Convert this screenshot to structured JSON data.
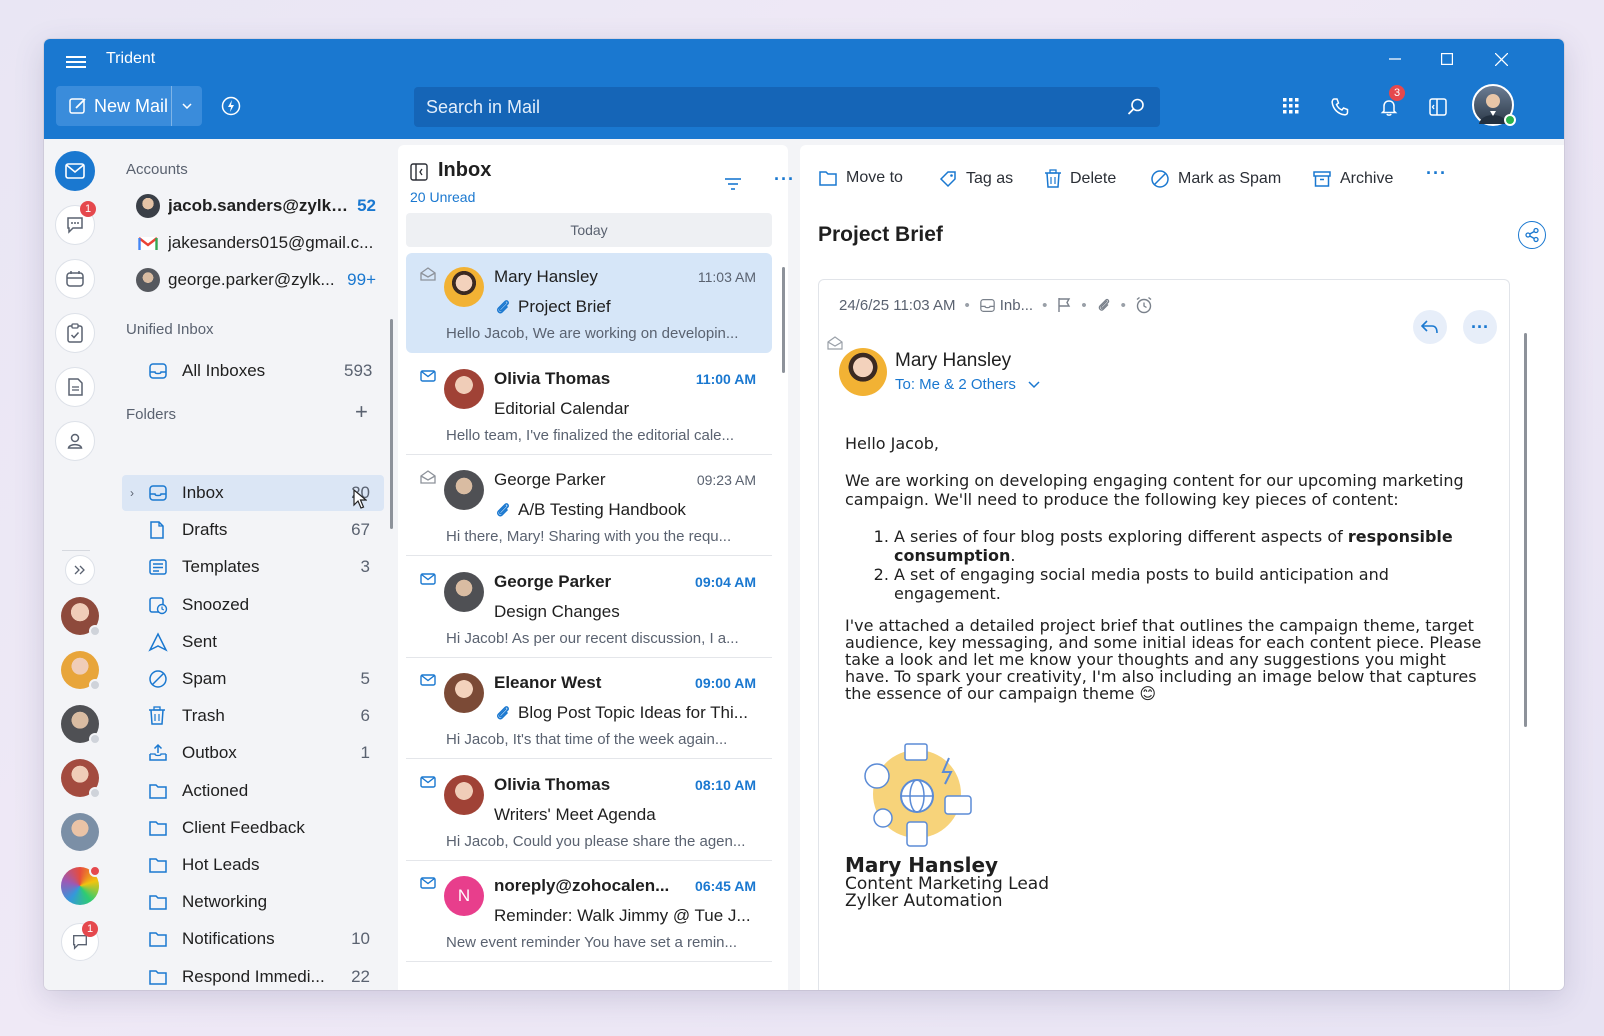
{
  "app": {
    "title": "Trident"
  },
  "titlebar": {
    "new_mail": "New Mail",
    "search_placeholder": "Search in Mail",
    "notif_count": "3"
  },
  "rail": {
    "chat_badge": "1",
    "bottom_chat_badge": "1"
  },
  "accounts_title": "Accounts",
  "accounts": [
    {
      "email": "jacob.sanders@zylke...",
      "count": "52"
    },
    {
      "email": "jakesanders015@gmail.c...",
      "count": ""
    },
    {
      "email": "george.parker@zylk...",
      "count": "99+"
    }
  ],
  "unified_title": "Unified Inbox",
  "unified": {
    "label": "All Inboxes",
    "count": "593"
  },
  "folders_title": "Folders",
  "folders": [
    {
      "label": "Inbox",
      "count": "20",
      "icon": "inbox-icon"
    },
    {
      "label": "Drafts",
      "count": "67",
      "icon": "draft-icon"
    },
    {
      "label": "Templates",
      "count": "3",
      "icon": "template-icon"
    },
    {
      "label": "Snoozed",
      "count": "",
      "icon": "snooze-icon"
    },
    {
      "label": "Sent",
      "count": "",
      "icon": "sent-icon"
    },
    {
      "label": "Spam",
      "count": "5",
      "icon": "spam-icon"
    },
    {
      "label": "Trash",
      "count": "6",
      "icon": "trash-icon"
    },
    {
      "label": "Outbox",
      "count": "1",
      "icon": "outbox-icon"
    },
    {
      "label": "Actioned",
      "count": "",
      "icon": "folder-icon"
    },
    {
      "label": "Client Feedback",
      "count": "",
      "icon": "folder-icon"
    },
    {
      "label": "Hot Leads",
      "count": "",
      "icon": "folder-icon"
    },
    {
      "label": "Networking",
      "count": "",
      "icon": "folder-icon"
    },
    {
      "label": "Notifications",
      "count": "10",
      "icon": "folder-icon"
    },
    {
      "label": "Respond Immedi...",
      "count": "22",
      "icon": "folder-icon"
    }
  ],
  "list": {
    "title": "Inbox",
    "unread": "20 Unread",
    "group": "Today",
    "messages": [
      {
        "from": "Mary Hansley",
        "time": "11:03 AM",
        "subject": "Project Brief",
        "preview": "Hello Jacob, We are working on developin...",
        "unread": false,
        "attach": true
      },
      {
        "from": "Olivia Thomas",
        "time": "11:00 AM",
        "subject": "Editorial Calendar",
        "preview": "Hello team, I've finalized the editorial cale...",
        "unread": true,
        "attach": false
      },
      {
        "from": "George Parker",
        "time": "09:23 AM",
        "subject": "A/B Testing Handbook",
        "preview": "Hi there, Mary! Sharing with you the requ...",
        "unread": false,
        "attach": true
      },
      {
        "from": "George Parker",
        "time": "09:04 AM",
        "subject": "Design Changes",
        "preview": "Hi Jacob! As per our recent discussion, I a...",
        "unread": true,
        "attach": false
      },
      {
        "from": "Eleanor West",
        "time": "09:00 AM",
        "subject": "Blog Post Topic Ideas for Thi...",
        "preview": "Hi Jacob, It's that time of the week again...",
        "unread": true,
        "attach": true
      },
      {
        "from": "Olivia Thomas",
        "time": "08:10 AM",
        "subject": "Writers' Meet Agenda",
        "preview": "Hi Jacob, Could you please share the agen...",
        "unread": true,
        "attach": false
      },
      {
        "from": "noreply@zohocalen...",
        "time": "06:45 AM",
        "subject": "Reminder: Walk Jimmy @ Tue J...",
        "preview": "New event reminder You have set a remin...",
        "unread": true,
        "attach": false,
        "initial": "N"
      }
    ]
  },
  "reader": {
    "toolbar": {
      "move": "Move to",
      "tag": "Tag as",
      "delete": "Delete",
      "spam": "Mark as Spam",
      "archive": "Archive"
    },
    "subject": "Project Brief",
    "meta_date": "24/6/25 11:03 AM",
    "meta_folder": "Inb...",
    "sender": "Mary Hansley",
    "to": "To: Me & 2 Others",
    "greeting": "Hello Jacob,",
    "para1": "We are working on developing engaging content for our upcoming marketing campaign. We'll need to produce the following key pieces of content:",
    "li1_pre": "A series of four blog posts exploring different aspects of ",
    "li1_bold": "responsible consumption",
    "li1_post": ".",
    "li2": "A set of engaging social media posts to build anticipation and engagement.",
    "para2": "I've attached a detailed project brief that outlines the campaign theme, target audience, key messaging, and some initial ideas for each content piece. Please take a look and let me know your thoughts and any suggestions you might have. To spark your creativity, I'm also including an image below that captures the essence of our campaign theme 😊",
    "sig_name": "Mary Hansley",
    "sig_title": "Content Marketing Lead",
    "sig_company": "Zylker Automation"
  },
  "colors": {
    "brand": "#1a78d0",
    "selected_row": "#d6e6f8",
    "badge": "#e5484d"
  }
}
